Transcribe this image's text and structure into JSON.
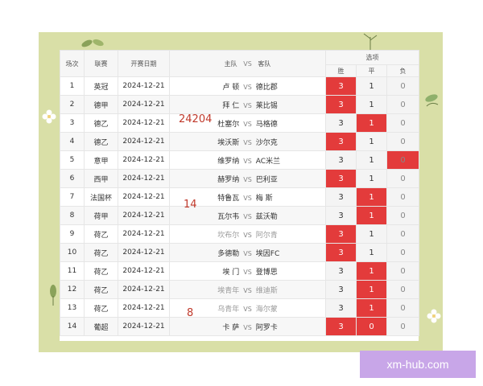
{
  "header": {
    "col_no": "场次",
    "col_league": "联赛",
    "col_date": "开赛日期",
    "col_match_home": "主队",
    "col_match_vs": "VS",
    "col_match_away": "客队",
    "col_options": "选项",
    "opt_win": "胜",
    "opt_draw": "平",
    "opt_loss": "负"
  },
  "numbers": {
    "a": "24204",
    "b": "14",
    "c": "8"
  },
  "rows": [
    {
      "no": "1",
      "league": "英冠",
      "date": "2024-12-21",
      "home": "卢 顿",
      "vs": "VS",
      "away": "德比郡",
      "w": "3",
      "d": "1",
      "l": "0",
      "sel": "w",
      "dim": false
    },
    {
      "no": "2",
      "league": "德甲",
      "date": "2024-12-21",
      "home": "拜 仁",
      "vs": "VS",
      "away": "莱比锡",
      "w": "3",
      "d": "1",
      "l": "0",
      "sel": "w",
      "dim": false
    },
    {
      "no": "3",
      "league": "德乙",
      "date": "2024-12-21",
      "home": "杜塞尔",
      "vs": "VS",
      "away": "马格德",
      "w": "3",
      "d": "1",
      "l": "0",
      "sel": "d",
      "dim": false
    },
    {
      "no": "4",
      "league": "德乙",
      "date": "2024-12-21",
      "home": "埃沃斯",
      "vs": "VS",
      "away": "沙尔克",
      "w": "3",
      "d": "1",
      "l": "0",
      "sel": "w",
      "dim": false
    },
    {
      "no": "5",
      "league": "意甲",
      "date": "2024-12-21",
      "home": "维罗纳",
      "vs": "VS",
      "away": "AC米兰",
      "w": "3",
      "d": "1",
      "l": "0",
      "sel": "l",
      "dim": false
    },
    {
      "no": "6",
      "league": "西甲",
      "date": "2024-12-21",
      "home": "赫罗纳",
      "vs": "VS",
      "away": "巴利亚",
      "w": "3",
      "d": "1",
      "l": "0",
      "sel": "w",
      "dim": false
    },
    {
      "no": "7",
      "league": "法国杯",
      "date": "2024-12-21",
      "home": "特鲁瓦",
      "vs": "VS",
      "away": "梅 斯",
      "w": "3",
      "d": "1",
      "l": "0",
      "sel": "d",
      "dim": false
    },
    {
      "no": "8",
      "league": "荷甲",
      "date": "2024-12-21",
      "home": "瓦尔韦",
      "vs": "VS",
      "away": "兹沃勒",
      "w": "3",
      "d": "1",
      "l": "0",
      "sel": "d",
      "dim": false
    },
    {
      "no": "9",
      "league": "荷乙",
      "date": "2024-12-21",
      "home": "坎布尔",
      "vs": "VS",
      "away": "阿尔青",
      "w": "3",
      "d": "1",
      "l": "0",
      "sel": "w",
      "dim": true
    },
    {
      "no": "10",
      "league": "荷乙",
      "date": "2024-12-21",
      "home": "多德勒",
      "vs": "VS",
      "away": "埃因FC",
      "w": "3",
      "d": "1",
      "l": "0",
      "sel": "w",
      "dim": false
    },
    {
      "no": "11",
      "league": "荷乙",
      "date": "2024-12-21",
      "home": "埃 门",
      "vs": "VS",
      "away": "登博思",
      "w": "3",
      "d": "1",
      "l": "0",
      "sel": "d",
      "dim": false
    },
    {
      "no": "12",
      "league": "荷乙",
      "date": "2024-12-21",
      "home": "埃青年",
      "vs": "VS",
      "away": "维迪斯",
      "w": "3",
      "d": "1",
      "l": "0",
      "sel": "d",
      "dim": true
    },
    {
      "no": "13",
      "league": "荷乙",
      "date": "2024-12-21",
      "home": "乌青年",
      "vs": "VS",
      "away": "海尔蒙",
      "w": "3",
      "d": "1",
      "l": "0",
      "sel": "d",
      "dim": true
    },
    {
      "no": "14",
      "league": "葡超",
      "date": "2024-12-21",
      "home": "卡 萨",
      "vs": "VS",
      "away": "阿罗卡",
      "w": "3",
      "d": "0",
      "l": "0",
      "sel": "wd",
      "dim": false
    }
  ],
  "watermark": "xm-hub.com",
  "colors": {
    "selected": "#e33b3b",
    "background": "#d9dfa7",
    "number": "#c0392b"
  }
}
